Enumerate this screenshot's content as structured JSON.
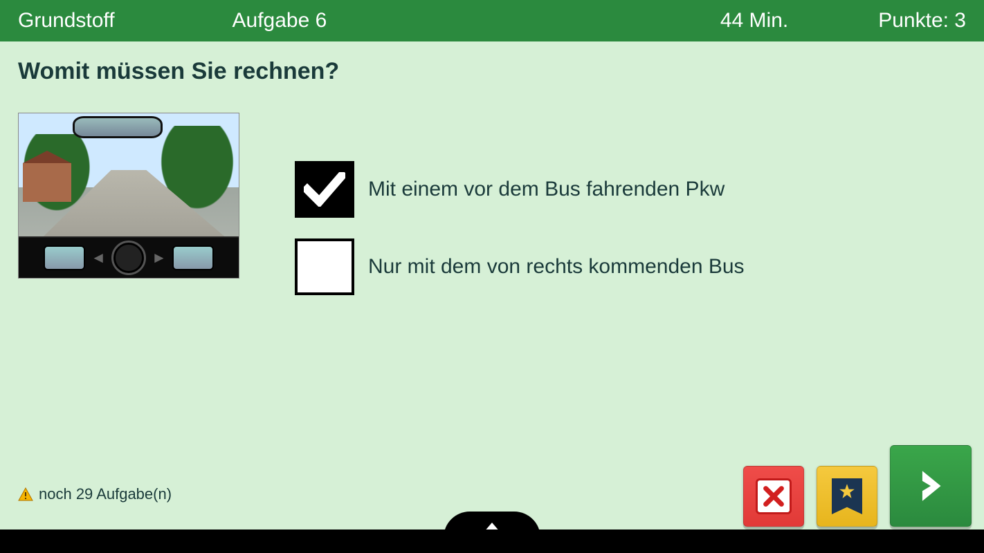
{
  "header": {
    "category": "Grundstoff",
    "task_label": "Aufgabe 6",
    "time_label": "44 Min.",
    "points_label": "Punkte: 3"
  },
  "question": "Womit müssen Sie rechnen?",
  "answers": [
    {
      "text": "Mit einem vor dem Bus fahrenden Pkw",
      "checked": true
    },
    {
      "text": "Nur mit dem von rechts kommenden Bus",
      "checked": false
    }
  ],
  "footer": {
    "remaining": "noch 29 Aufgabe(n)"
  },
  "buttons": {
    "cancel": "cancel",
    "bookmark": "bookmark",
    "next": "next"
  }
}
